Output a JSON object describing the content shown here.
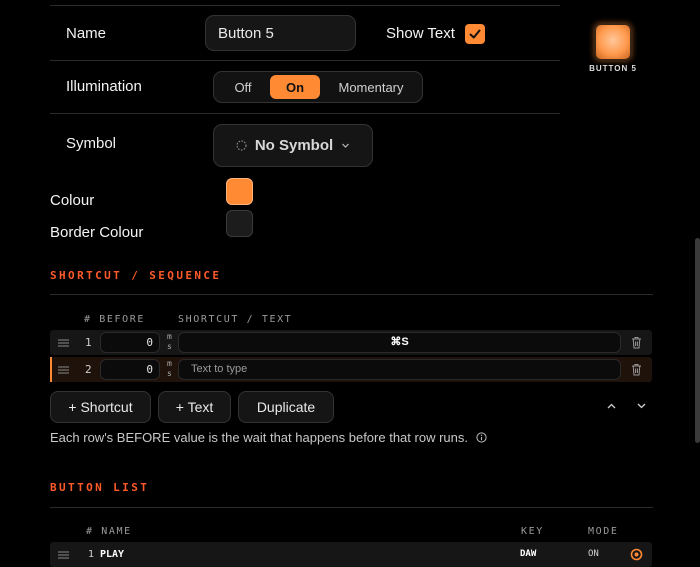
{
  "settings": {
    "name_label": "Name",
    "name_value": "Button 5",
    "show_text_label": "Show Text",
    "show_text_checked": true,
    "illumination_label": "Illumination",
    "illumination_options": [
      "Off",
      "On",
      "Momentary"
    ],
    "illumination_selected": "On",
    "symbol_label": "Symbol",
    "symbol_value": "No Symbol",
    "colour_label": "Colour",
    "colour_value": "#ff8a33",
    "border_colour_label": "Border Colour",
    "border_colour_value": "#1c1c1c"
  },
  "preview": {
    "caption": "BUTTON 5"
  },
  "shortcut": {
    "heading": "SHORTCUT / SEQUENCE",
    "col_before": "# BEFORE",
    "col_shortcut": "SHORTCUT / TEXT",
    "unit": [
      "m",
      "s"
    ],
    "rows": [
      {
        "index": "1",
        "before": "0",
        "text": "⌘S",
        "placeholder": "",
        "selected": false
      },
      {
        "index": "2",
        "before": "0",
        "text": "",
        "placeholder": "Text to type",
        "selected": true
      }
    ],
    "add_shortcut_label": "+ Shortcut",
    "add_text_label": "+ Text",
    "duplicate_label": "Duplicate",
    "help_text": "Each row's BEFORE value is the wait that happens before that row runs."
  },
  "button_list": {
    "heading": "BUTTON LIST",
    "col_name": "# NAME",
    "col_key": "KEY",
    "col_mode": "MODE",
    "rows": [
      {
        "index": "1",
        "name": "PLAY",
        "key": "DAW",
        "mode": "ON"
      }
    ]
  },
  "colors": {
    "accent": "#ff8a33",
    "section_heading": "#ff5a2a"
  }
}
